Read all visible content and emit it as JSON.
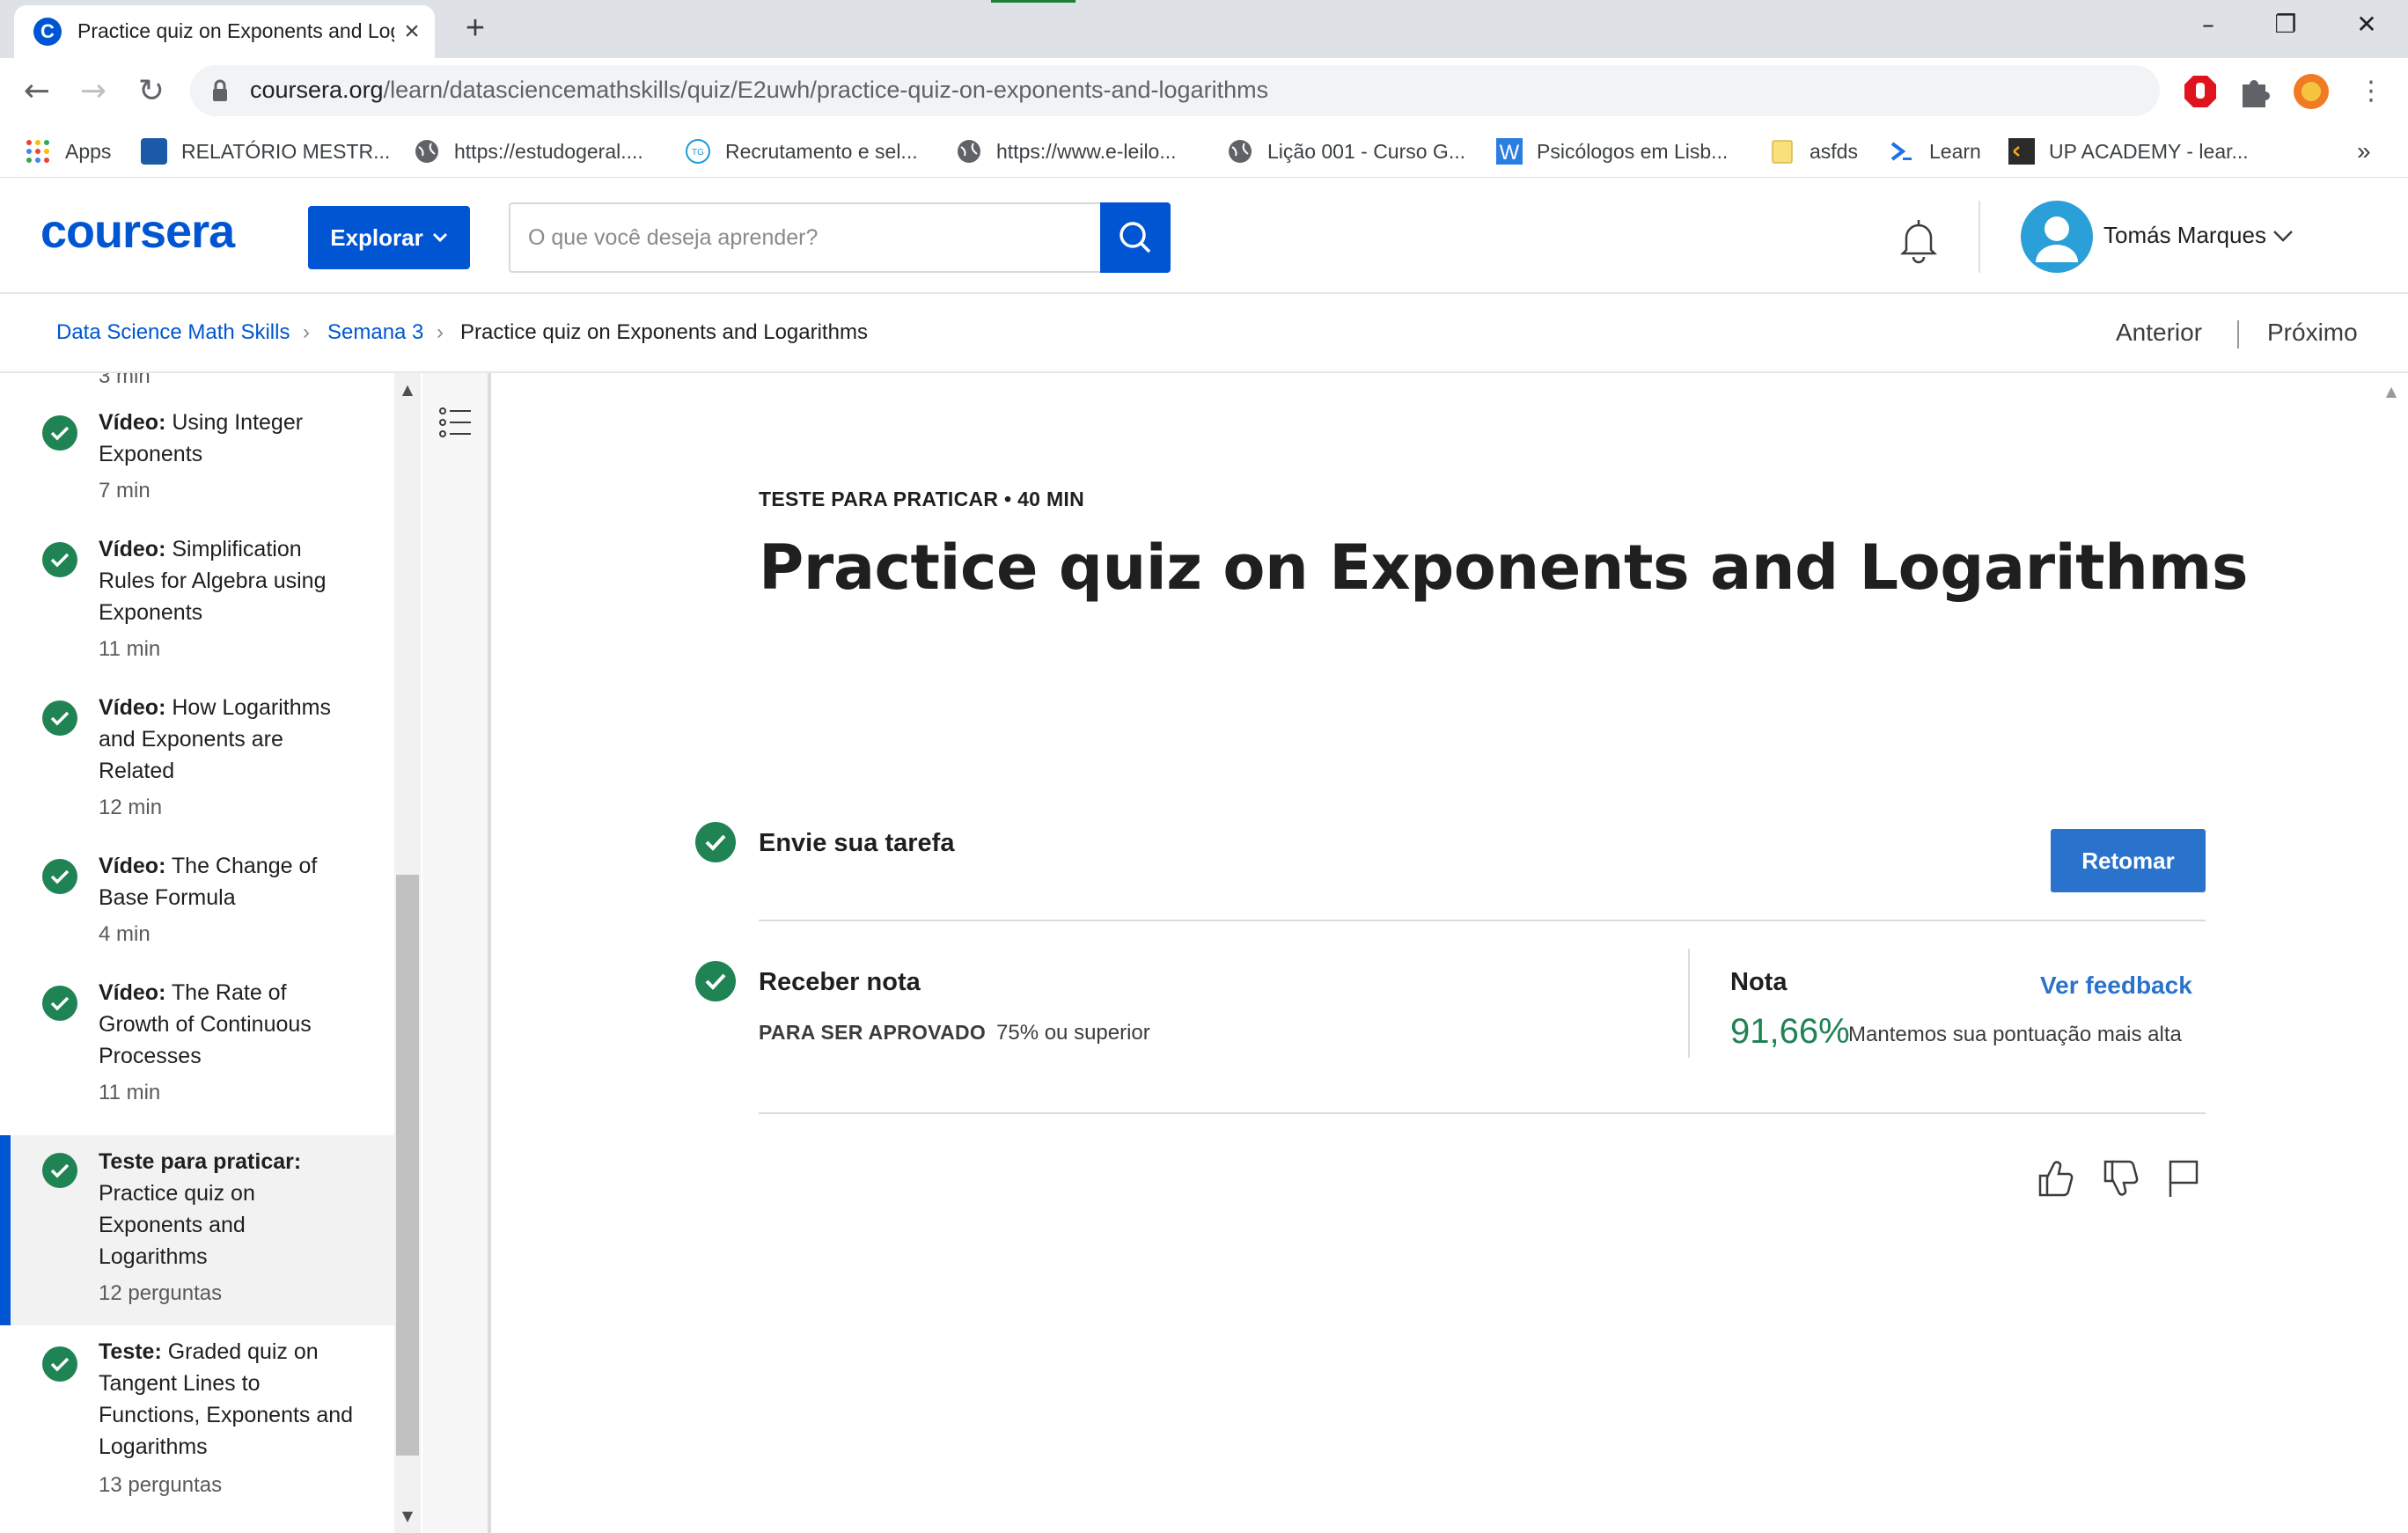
{
  "browser": {
    "tab_title": "Practice quiz on Exponents and Logarithms | Coursera",
    "url_host": "coursera.org",
    "url_path": "/learn/datasciencemathskills/quiz/E2uwh/practice-quiz-on-exponents-and-logarithms",
    "bookmarks": [
      {
        "label": "Apps",
        "icon": "apps-grid-icon"
      },
      {
        "label": "RELATÓRIO MESTR...",
        "icon": "bookmark-logo-icon"
      },
      {
        "label": "https://estudogeral....",
        "icon": "globe-icon"
      },
      {
        "label": "Recrutamento e sel...",
        "icon": "tg-logo-icon"
      },
      {
        "label": "https://www.e-leilo...",
        "icon": "globe-icon"
      },
      {
        "label": "Lição 001 - Curso G...",
        "icon": "globe-icon"
      },
      {
        "label": "Psicólogos em Lisb...",
        "icon": "w-logo-icon"
      },
      {
        "label": "asfds",
        "icon": "folder-icon"
      },
      {
        "label": "Learn",
        "icon": "terminal-icon"
      },
      {
        "label": "UP ACADEMY - lear...",
        "icon": "dark-logo-icon"
      }
    ],
    "bookmarks_overflow": "»"
  },
  "header": {
    "logo": "coursera",
    "explore_label": "Explorar",
    "search_placeholder": "O que você deseja aprender?",
    "user_name": "Tomás Marques"
  },
  "breadcrumb": {
    "course": "Data Science Math Skills",
    "week": "Semana 3",
    "current": "Practice quiz on Exponents and Logarithms",
    "prev": "Anterior",
    "next": "Próximo"
  },
  "sidebar": {
    "cut_meta": "3 min",
    "items": [
      {
        "type": "Vídeo:",
        "title": "Using Integer Exponents",
        "meta": "7 min"
      },
      {
        "type": "Vídeo:",
        "title": "Simplification Rules for Algebra using Exponents",
        "meta": "11 min"
      },
      {
        "type": "Vídeo:",
        "title": "How Logarithms and Exponents are Related",
        "meta": "12 min"
      },
      {
        "type": "Vídeo:",
        "title": "The Change of Base Formula",
        "meta": "4 min"
      },
      {
        "type": "Vídeo:",
        "title": "The Rate of Growth of Continuous Processes",
        "meta": "11 min"
      },
      {
        "type": "Teste para praticar:",
        "title": "Practice quiz on Exponents and Logarithms",
        "meta": "12 perguntas"
      },
      {
        "type": "Teste:",
        "title": "Graded quiz on Tangent Lines to Functions, Exponents and Logarithms",
        "meta": "13 perguntas"
      }
    ]
  },
  "main": {
    "meta": "TESTE PARA PRATICAR • 40 MIN",
    "title": "Practice quiz on Exponents and Logarithms",
    "submit_label": "Envie sua tarefa",
    "resume_label": "Retomar",
    "grade_label": "Receber nota",
    "pass_label": "PARA SER APROVADO",
    "pass_value": "75% ou superior",
    "nota_label": "Nota",
    "feedback_label": "Ver feedback",
    "score": "91,66%",
    "score_note": "Mantemos sua pontuação mais alta"
  },
  "colors": {
    "brand": "#0056d2",
    "success": "#1f8354",
    "button": "#2a73cc"
  }
}
